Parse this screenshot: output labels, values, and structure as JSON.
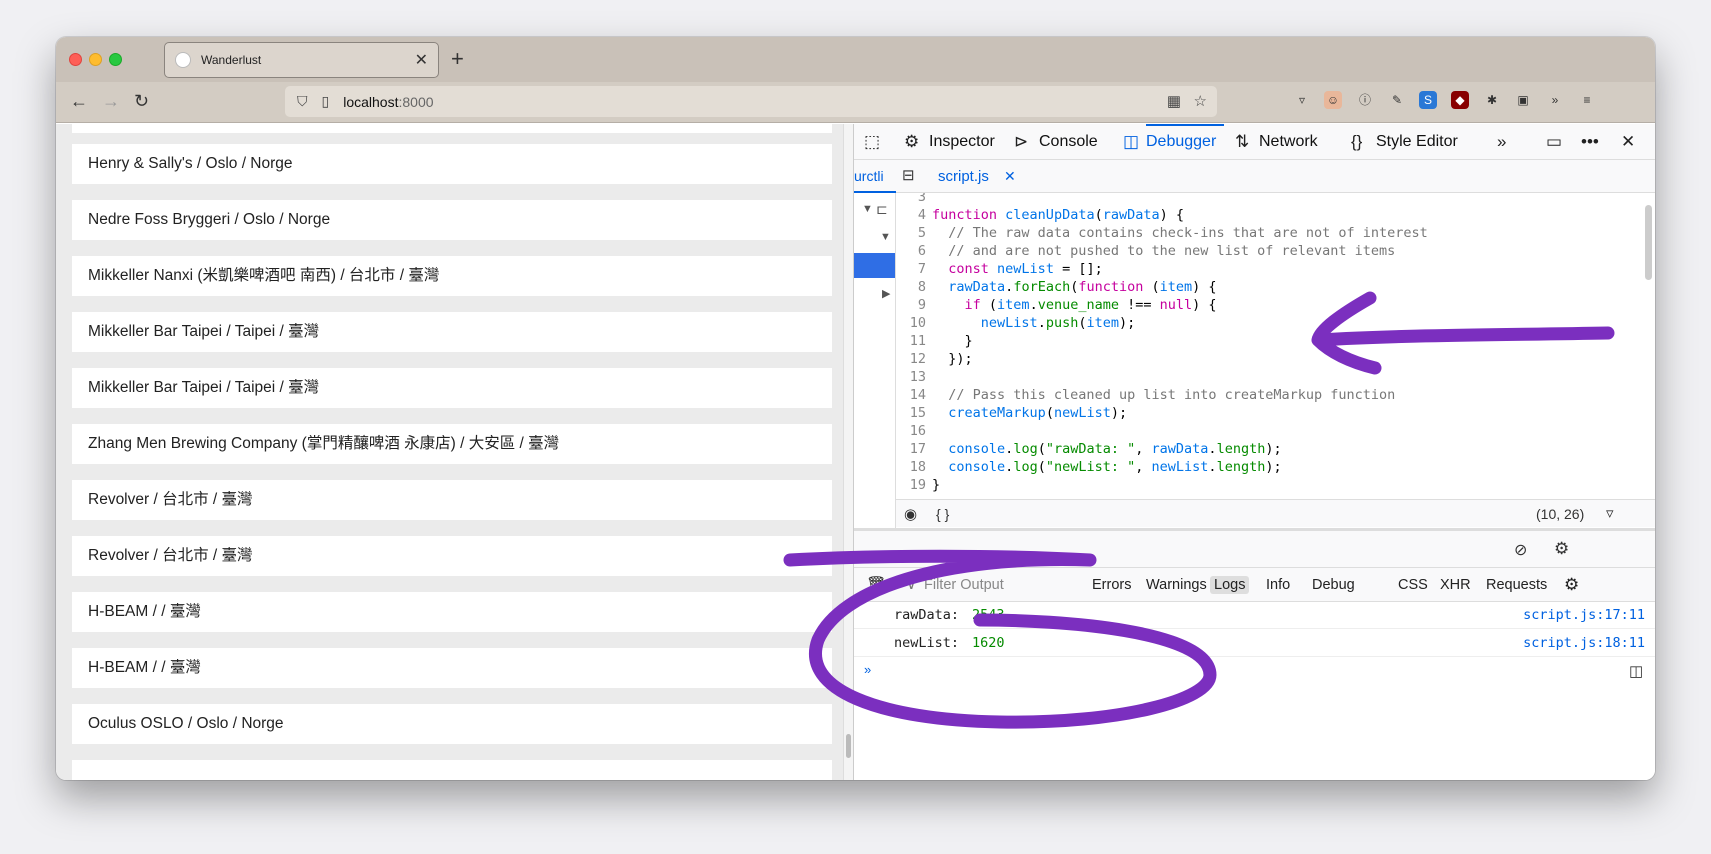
{
  "browser": {
    "tab_title": "Wanderlust",
    "url_host": "localhost",
    "url_port": ":8000"
  },
  "page": {
    "items": [
      "Henry & Sally's / Oslo / Norge",
      "Nedre Foss Bryggeri / Oslo / Norge",
      "Mikkeller Nanxi (米凱樂啤酒吧 南西) / 台北市 / 臺灣",
      "Mikkeller Bar Taipei / Taipei / 臺灣",
      "Mikkeller Bar Taipei / Taipei / 臺灣",
      "Zhang Men Brewing Company (掌門精釀啤酒 永康店) / 大安區 / 臺灣",
      "Revolver / 台北市 / 臺灣",
      "Revolver / 台北市 / 臺灣",
      "H-BEAM / / 臺灣",
      "H-BEAM / / 臺灣",
      "Oculus OSLO / Oslo / Norge"
    ]
  },
  "devtools": {
    "tabs": {
      "inspector": "Inspector",
      "console": "Console",
      "debugger": "Debugger",
      "network": "Network",
      "style_editor": "Style Editor"
    },
    "source_tab": "script.js",
    "cursor_position": "(10, 26)",
    "pretty_print": "{ }",
    "console_filter_placeholder": "Filter Output",
    "console_filters": [
      "Errors",
      "Warnings",
      "Logs",
      "Info",
      "Debug",
      "CSS",
      "XHR",
      "Requests"
    ],
    "console_output": [
      {
        "label": "rawData:",
        "value": "2543",
        "source": "script.js:17:11"
      },
      {
        "label": "newList:",
        "value": "1620",
        "source": "script.js:18:11"
      }
    ]
  },
  "colors": {
    "annotation": "#7b2fbf",
    "devtools_accent": "#0061e0"
  }
}
